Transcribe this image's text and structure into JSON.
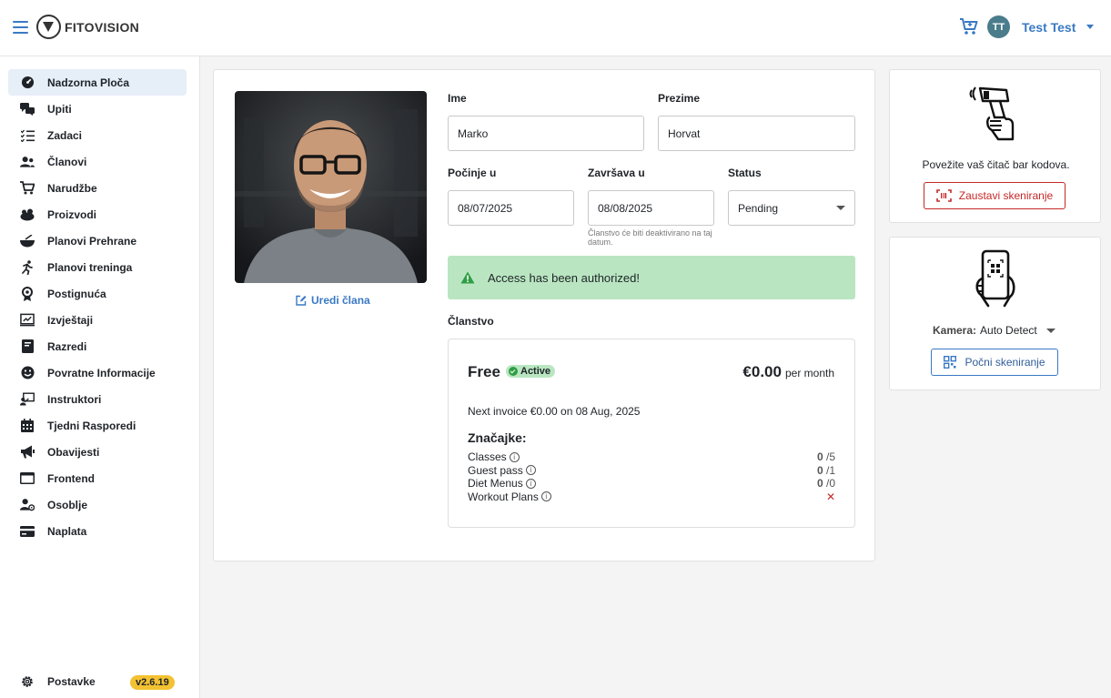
{
  "header": {
    "brand": "FITOVISION",
    "avatar_initials": "TT",
    "user_name": "Test Test"
  },
  "sidebar": {
    "items": [
      {
        "label": "Nadzorna Ploča",
        "icon": "dashboard-icon"
      },
      {
        "label": "Upiti",
        "icon": "chat-icon"
      },
      {
        "label": "Zadaci",
        "icon": "checklist-icon"
      },
      {
        "label": "Članovi",
        "icon": "users-icon"
      },
      {
        "label": "Narudžbe",
        "icon": "cart-icon"
      },
      {
        "label": "Proizvodi",
        "icon": "products-icon"
      },
      {
        "label": "Planovi Prehrane",
        "icon": "bowl-icon"
      },
      {
        "label": "Planovi treninga",
        "icon": "runner-icon"
      },
      {
        "label": "Postignuća",
        "icon": "award-icon"
      },
      {
        "label": "Izvještaji",
        "icon": "report-icon"
      },
      {
        "label": "Razredi",
        "icon": "book-icon"
      },
      {
        "label": "Povratne Informacije",
        "icon": "smiley-icon"
      },
      {
        "label": "Instruktori",
        "icon": "instructor-icon"
      },
      {
        "label": "Tjedni Rasporedi",
        "icon": "calendar-icon"
      },
      {
        "label": "Obavijesti",
        "icon": "megaphone-icon"
      },
      {
        "label": "Frontend",
        "icon": "window-icon"
      },
      {
        "label": "Osoblje",
        "icon": "staff-icon"
      },
      {
        "label": "Naplata",
        "icon": "card-icon"
      }
    ],
    "settings_label": "Postavke",
    "version": "v2.6.19"
  },
  "member": {
    "edit_label": "Uredi člana",
    "first_name_label": "Ime",
    "first_name": "Marko",
    "last_name_label": "Prezime",
    "last_name": "Horvat",
    "start_label": "Počinje u",
    "start_date": "08/07/2025",
    "end_label": "Završava u",
    "end_date": "08/08/2025",
    "end_hint": "Članstvo će biti deaktivirano na taj datum.",
    "status_label": "Status",
    "status_value": "Pending"
  },
  "alert": {
    "message": "Access has been authorized!"
  },
  "membership": {
    "section_title": "Članstvo",
    "plan_name": "Free",
    "plan_status": "Active",
    "price": "€0.00",
    "period": "per month",
    "next_invoice": "Next invoice €0.00 on 08 Aug, 2025",
    "features_title": "Značajke:",
    "features": [
      {
        "name": "Classes",
        "used": "0",
        "limit": "/5"
      },
      {
        "name": "Guest pass",
        "used": "0",
        "limit": "/1"
      },
      {
        "name": "Diet Menus",
        "used": "0",
        "limit": "/0"
      },
      {
        "name": "Workout Plans",
        "used": "",
        "limit": "✕"
      }
    ]
  },
  "scanner": {
    "text": "Povežite vaš čitač bar kodova.",
    "stop_label": "Zaustavi skeniranje"
  },
  "camera": {
    "label": "Kamera:",
    "value": "Auto Detect",
    "start_label": "Počni skeniranje"
  },
  "colors": {
    "accent": "#3a79c4",
    "success_bg": "#b9e6c1",
    "danger": "#c62828",
    "version_badge": "#f3c232"
  }
}
